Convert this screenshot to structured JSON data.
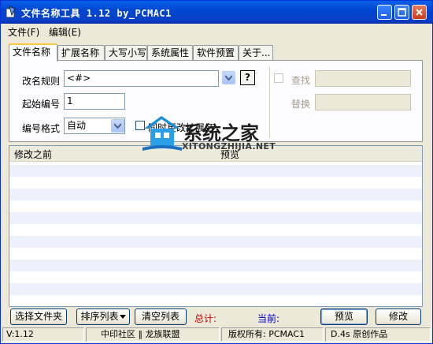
{
  "window": {
    "title": "文件名称工具 1.12  by_PCMAC1"
  },
  "menu": {
    "file": "文件(F)",
    "edit": "编辑(E)"
  },
  "tabs": [
    "文件名称",
    "扩展名称",
    "大写小写",
    "系统属性",
    "软件预置",
    "关于..."
  ],
  "form": {
    "rename_rule_label": "改名规则",
    "rename_rule_value": "<#>",
    "help_label": "?",
    "start_num_label": "起始编号",
    "start_num_value": "1",
    "num_format_label": "编号格式",
    "num_format_value": "自动",
    "change_ext_label": "同时更改扩展名",
    "find_label": "查找",
    "replace_label": "替换"
  },
  "list": {
    "col_before": "修改之前",
    "col_preview": "预览"
  },
  "buttons": {
    "select_folder": "选择文件夹",
    "sort_list": "排序列表",
    "clear_list": "清空列表",
    "preview": "预览",
    "modify": "修改"
  },
  "stats": {
    "total_label": "总计:",
    "current_label": "当前:"
  },
  "statusbar": {
    "version": "V:1.12",
    "community": "中印社区 ‖ 龙族联盟",
    "copyright": "版权所有: PCMAC1",
    "credit": "D.4s 原创作品"
  },
  "watermark": {
    "main": "系统之家",
    "sub": "XITONGZHIJIA.NET"
  },
  "colors": {
    "title_blue": "#0a5fe8",
    "total_red": "#c00000",
    "current_blue": "#0000c0"
  }
}
